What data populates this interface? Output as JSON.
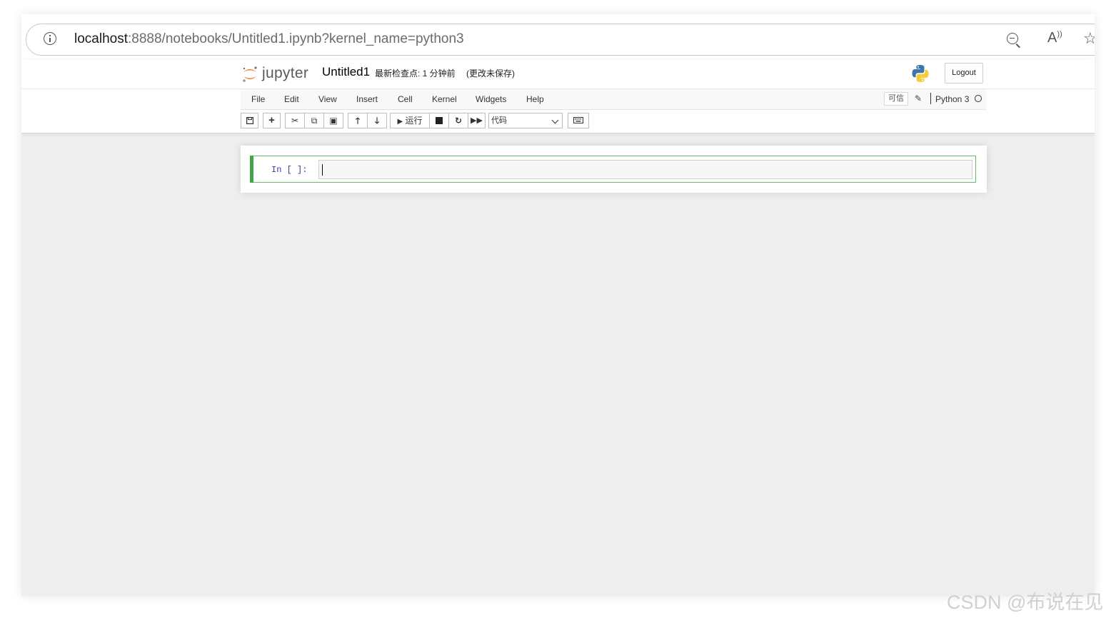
{
  "browser": {
    "url_host": "localhost",
    "url_rest": ":8888/notebooks/Untitled1.ipynb?kernel_name=python3"
  },
  "header": {
    "logo_text": "jupyter",
    "notebook_title": "Untitled1",
    "checkpoint_status": "最新检查点: 1 分钟前",
    "autosave_status": "(更改未保存)",
    "logout_label": "Logout"
  },
  "menu": {
    "items": [
      "File",
      "Edit",
      "View",
      "Insert",
      "Cell",
      "Kernel",
      "Widgets",
      "Help"
    ],
    "trusted_label": "可信",
    "kernel_name": "Python 3"
  },
  "toolbar": {
    "run_label": "运行",
    "cell_type_selected": "代码"
  },
  "cell": {
    "prompt": "In [ ]:"
  },
  "watermark": "CSDN @布说在见"
}
